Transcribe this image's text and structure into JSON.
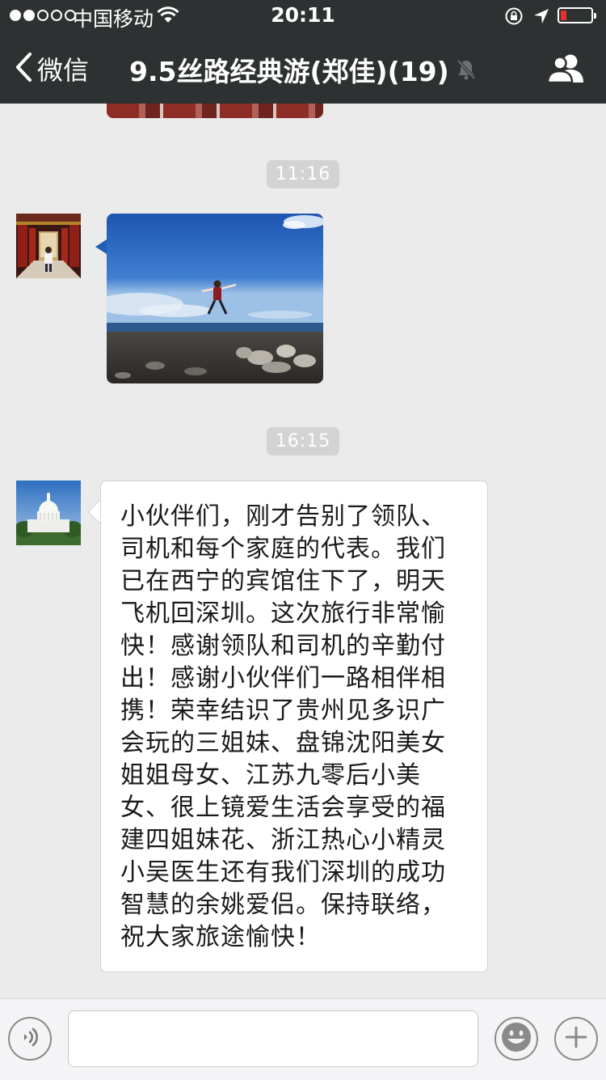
{
  "status_bar": {
    "carrier": "中国移动",
    "time": "20:11",
    "signal_bars_filled": 2,
    "signal_bars_total": 5,
    "battery_level": 0.2,
    "battery_color": "#e5312b",
    "icons": [
      "wifi-icon",
      "rotation-lock-icon",
      "location-arrow-icon",
      "battery-icon"
    ]
  },
  "nav": {
    "back_label": "微信",
    "title": "9.5丝路经典游(郑佳)(19)",
    "icons": [
      "back-chevron-icon",
      "mute-bell-icon",
      "group-members-icon"
    ],
    "background_color": "#2e3132"
  },
  "chat": {
    "background_color": "#ebebeb",
    "messages": [
      {
        "type": "image",
        "partial": true,
        "description_icon": "photo-thumbnail"
      },
      {
        "type": "timestamp",
        "text": "11:16"
      },
      {
        "type": "image",
        "sender_avatar": "avatar-temple-child",
        "description_icon": "photo-jumping-person-lakeshore"
      },
      {
        "type": "timestamp",
        "text": "16:15"
      },
      {
        "type": "text",
        "sender_avatar": "avatar-capitol-building",
        "text": "小伙伴们，刚才告别了领队、司机和每个家庭的代表。我们已在西宁的宾馆住下了，明天飞机回深圳。这次旅行非常愉快！感谢领队和司机的辛勤付出！感谢小伙伴们一路相伴相携！荣幸结识了贵州见多识广会玩的三姐妹、盘锦沈阳美女姐姐母女、江苏九零后小美女、很上镜爱生活会享受的福建四姐妹花、浙江热心小精灵小吴医生还有我们深圳的成功智慧的余姚爱侣。保持联络，祝大家旅途愉快！"
      }
    ]
  },
  "input_bar": {
    "input_value": "",
    "icons": [
      "voice-icon",
      "emoji-icon",
      "plus-icon"
    ]
  }
}
